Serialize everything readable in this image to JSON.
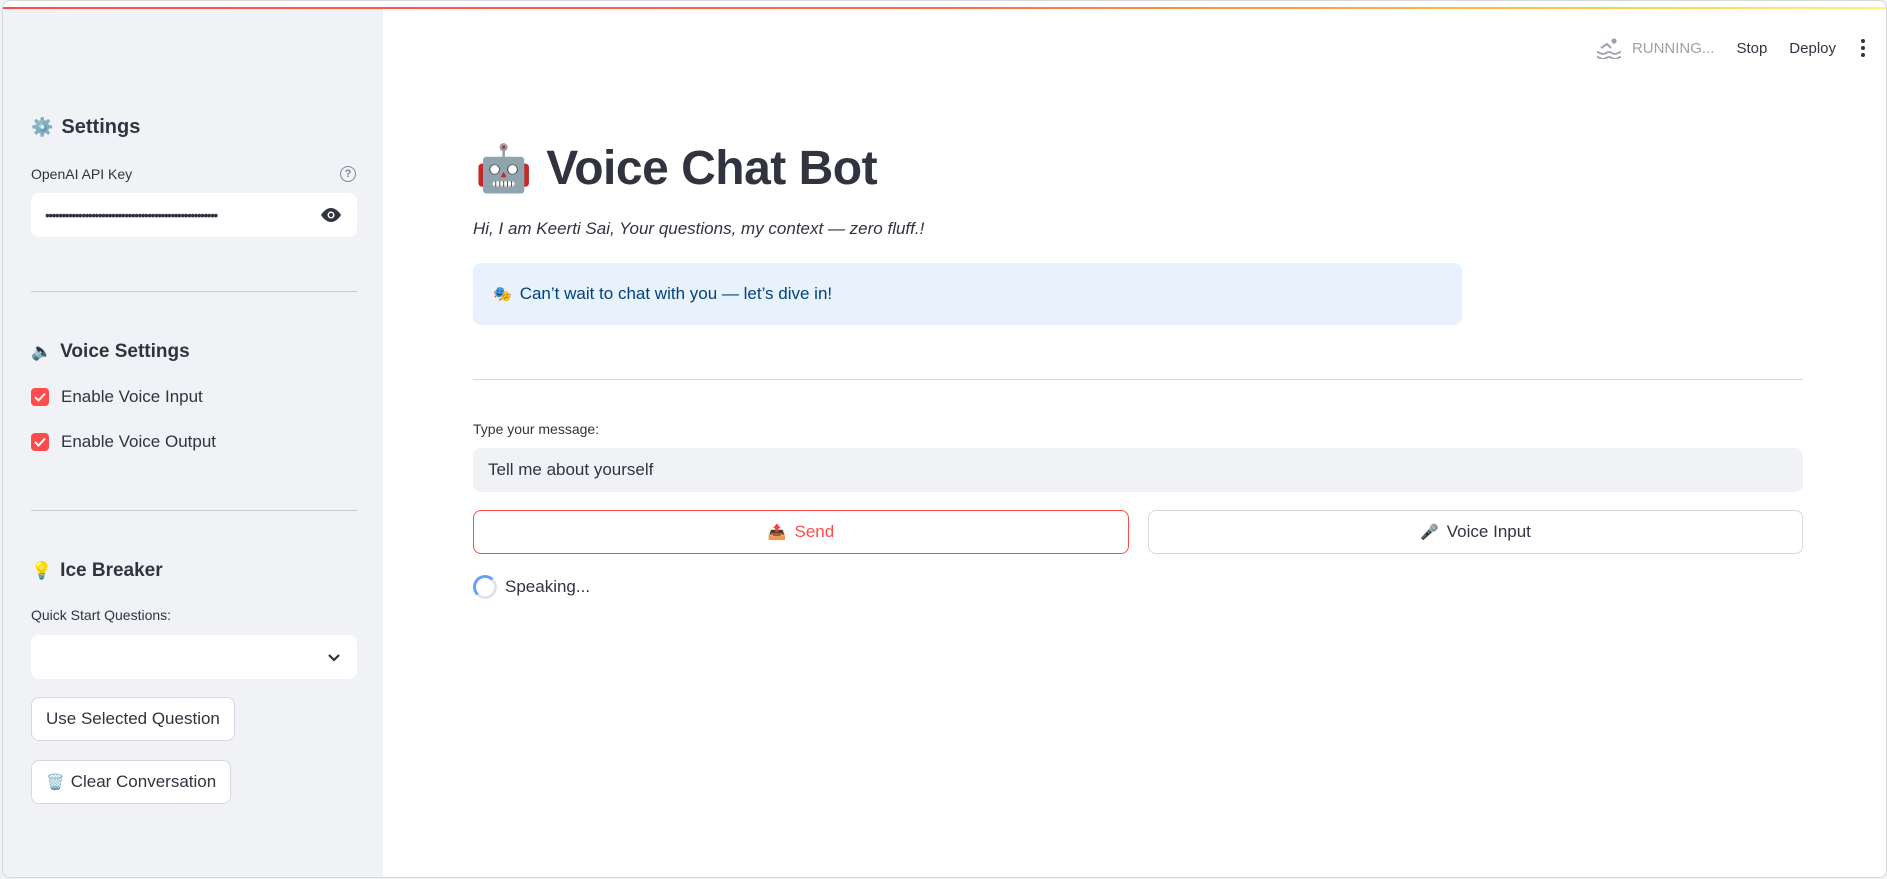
{
  "toolbar": {
    "status": "RUNNING...",
    "stop_label": "Stop",
    "deploy_label": "Deploy",
    "status_icon": "swimmer-icon",
    "menu_icon": "kebab-menu-icon"
  },
  "sidebar": {
    "settings_heading": "Settings",
    "settings_icon": "⚙️",
    "api_key_label": "OpenAI API Key",
    "api_key_value": "••••••••••••••••••••••••••••••••••••••••••••••••••••",
    "voice_heading": "Voice Settings",
    "voice_icon": "🔈",
    "enable_voice_input": {
      "label": "Enable Voice Input",
      "checked": true
    },
    "enable_voice_output": {
      "label": "Enable Voice Output",
      "checked": true
    },
    "ice_heading": "Ice Breaker",
    "ice_icon": "💡",
    "quick_start_label": "Quick Start Questions:",
    "quick_start_value": "",
    "use_selected_label": "Use Selected Question",
    "clear_label": "Clear Conversation",
    "clear_icon": "🗑️"
  },
  "main": {
    "title_icon": "🤖",
    "title": "Voice Chat Bot",
    "subtitle": "Hi, I am Keerti Sai, Your questions, my context — zero fluff.!",
    "info_icon": "🎭",
    "info_text": "Can’t wait to chat with you — let’s dive in!",
    "message_label": "Type your message:",
    "message_value": "Tell me about yourself",
    "send_icon": "📤",
    "send_label": "Send",
    "voice_icon": "🎤",
    "voice_label": "Voice Input",
    "status_text": "Speaking..."
  },
  "colors": {
    "accent": "#ff4b4b",
    "sidebar_bg": "#f0f2f6",
    "info_bg": "#e8f2fc",
    "info_text": "#004280"
  }
}
